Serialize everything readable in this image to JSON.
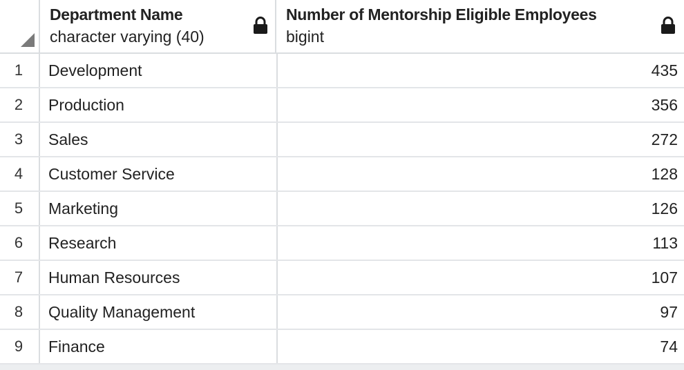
{
  "columns": [
    {
      "name": "Department Name",
      "type": "character varying (40)",
      "icon": "lock-icon"
    },
    {
      "name": "Number of Mentorship Eligible Employees",
      "type": "bigint",
      "icon": "lock-icon"
    }
  ],
  "rows": [
    {
      "num": "1",
      "department": "Development",
      "count": "435"
    },
    {
      "num": "2",
      "department": "Production",
      "count": "356"
    },
    {
      "num": "3",
      "department": "Sales",
      "count": "272"
    },
    {
      "num": "4",
      "department": "Customer Service",
      "count": "128"
    },
    {
      "num": "5",
      "department": "Marketing",
      "count": "126"
    },
    {
      "num": "6",
      "department": "Research",
      "count": "113"
    },
    {
      "num": "7",
      "department": "Human Resources",
      "count": "107"
    },
    {
      "num": "8",
      "department": "Quality Management",
      "count": "97"
    },
    {
      "num": "9",
      "department": "Finance",
      "count": "74"
    }
  ],
  "colors": {
    "grid_line": "#dadde0",
    "background": "#eceef0",
    "text": "#222222"
  }
}
